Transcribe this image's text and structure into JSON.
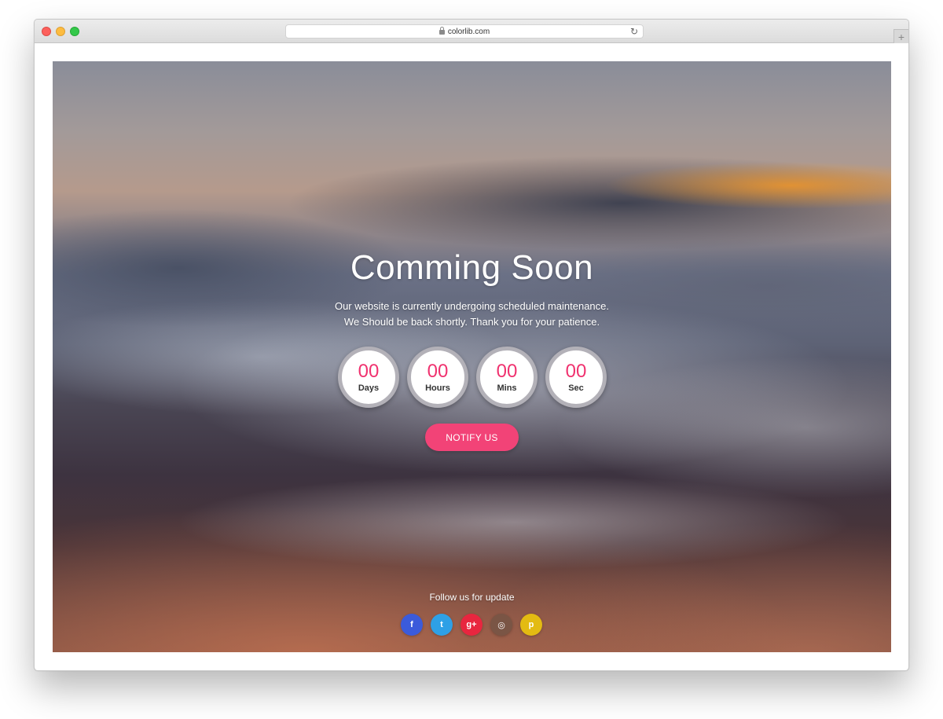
{
  "browser": {
    "url": "colorlib.com",
    "reload_glyph": "↻",
    "newtab_glyph": "+"
  },
  "hero": {
    "title": "Comming Soon",
    "subtitle_line1": "Our website is currently undergoing scheduled maintenance.",
    "subtitle_line2": "We Should be back shortly. Thank you for your patience."
  },
  "countdown": [
    {
      "value": "00",
      "label": "Days"
    },
    {
      "value": "00",
      "label": "Hours"
    },
    {
      "value": "00",
      "label": "Mins"
    },
    {
      "value": "00",
      "label": "Sec"
    }
  ],
  "notify": {
    "label": "NOTIFY US"
  },
  "follow": {
    "text": "Follow us for update"
  },
  "social": [
    {
      "name": "facebook-icon",
      "glyph": "f",
      "color": "#3b5bdb"
    },
    {
      "name": "twitter-icon",
      "glyph": "t",
      "color": "#2ea0e6"
    },
    {
      "name": "google-plus-icon",
      "glyph": "g+",
      "color": "#e8263f"
    },
    {
      "name": "instagram-icon",
      "glyph": "◎",
      "color": "#7a5545"
    },
    {
      "name": "pinterest-icon",
      "glyph": "p",
      "color": "#e3bb12"
    }
  ],
  "colors": {
    "accent": "#f24377",
    "count_text": "#f0326f"
  }
}
